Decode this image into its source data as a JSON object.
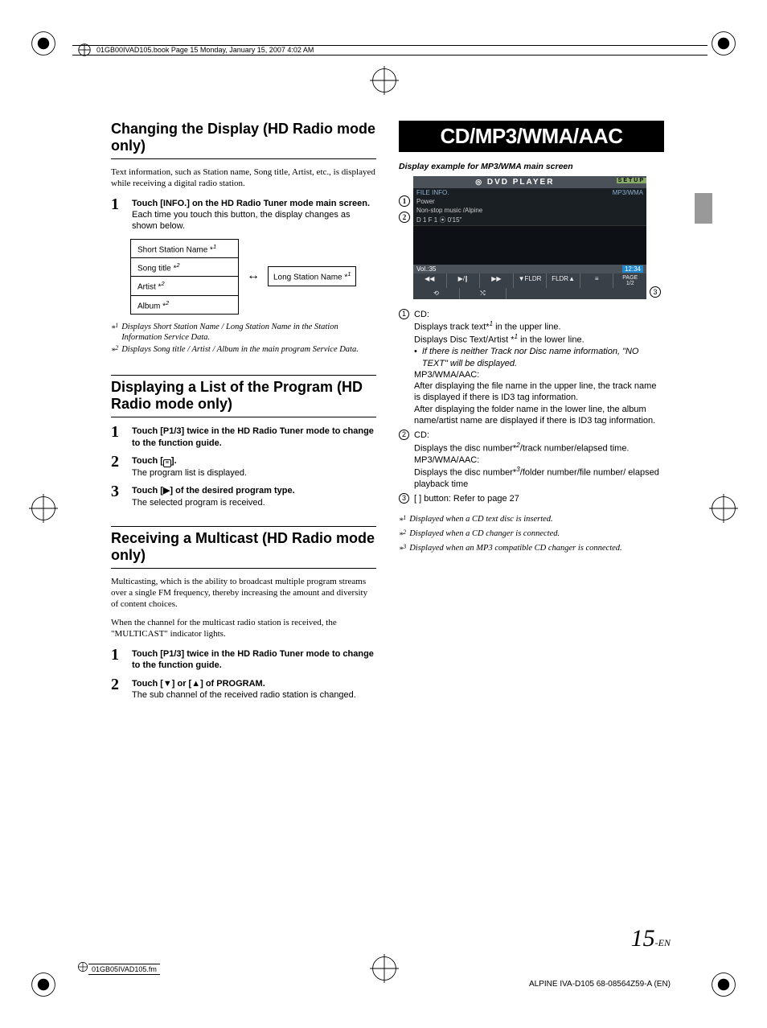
{
  "header_text": "01GB00IVAD105.book  Page 15  Monday, January 15, 2007  4:02 AM",
  "left": {
    "sec1_title": "Changing the Display (HD Radio mode only)",
    "sec1_intro": "Text information, such as Station name, Song title, Artist, etc., is displayed while receiving a digital radio station.",
    "step1_bold_a": "Touch ",
    "step1_key": "[INFO.]",
    "step1_bold_b": " on the HD Radio Tuner mode main screen.",
    "step1_reg": "Each time you touch this button, the display changes as shown below.",
    "seq": {
      "b1": "Short Station Name",
      "b2": "Song title",
      "b3": "Artist",
      "b4": "Album",
      "long": "Long Station Name"
    },
    "fn1": "Displays Short Station Name / Long Station Name in the Station Information Service Data.",
    "fn2": "Displays Song title / Artist / Album in the main program Service Data.",
    "sec2_title": "Displaying a List of the Program (HD Radio mode only)",
    "s2_1_a": "Touch ",
    "s2_1_key": "[P1/3]",
    "s2_1_b": " twice in the HD Radio Tuner mode to change to the function guide.",
    "s2_2_a": "Touch [",
    "s2_2_b": "].",
    "s2_2_reg": "The program list is displayed.",
    "s2_3_a": "Touch [",
    "s2_3_b": "] of the desired program type.",
    "s2_3_reg": "The selected program is received.",
    "sec3_title": "Receiving a Multicast (HD Radio mode only)",
    "sec3_intro1": "Multicasting, which is the ability to broadcast multiple program streams over a single FM frequency, thereby increasing the amount and diversity of content choices.",
    "sec3_intro2": "When the channel for the multicast radio station is received, the \"MULTICAST\" indicator lights.",
    "s3_1_a": "Touch ",
    "s3_1_key": "[P1/3]",
    "s3_1_b": " twice in the HD Radio Tuner mode to change to the function guide.",
    "s3_2": "Touch [▼] or [▲] of PROGRAM.",
    "s3_2_reg": "The sub channel of the received radio station is changed."
  },
  "right": {
    "banner": "CD/MP3/WMA/AAC",
    "caption": "Display example for MP3/WMA main screen",
    "scr": {
      "title": "DVD PLAYER",
      "setup": "SETUP",
      "file_info": "FILE INFO.",
      "fmt": "MP3/WMA",
      "line_power": "Power",
      "line_artist": "Non-stop music /Alpine",
      "disc": "D 1   F 1      ⦿    0'15\"",
      "vol": "Vol.:35",
      "time": "12:34",
      "btns": [
        "◀◀",
        "▶/∥",
        "▶▶",
        "▼FLDR",
        "FLDR▲"
      ],
      "btns2": [
        "⟲",
        "⤭"
      ]
    },
    "d1_label": "CD:",
    "d1_l1a": "Displays track text*",
    "d1_l1b": " in the upper line.",
    "d1_l2a": "Displays Disc Text/Artist *",
    "d1_l2b": " in the lower line.",
    "d1_bullet": "If there is neither Track nor Disc name information, \"NO TEXT\" will be displayed.",
    "d1_mp3": "MP3/WMA/AAC:",
    "d1_mp3_a": "After displaying the file name in the upper line, the track name is displayed if there is ID3 tag information.",
    "d1_mp3_b": "After displaying the folder name in the lower line, the album name/artist name are displayed if there is ID3 tag information.",
    "d2_label": "CD:",
    "d2_l1a": "Displays the disc number*",
    "d2_l1b": "/track number/elapsed time.",
    "d2_mp3": "MP3/WMA/AAC:",
    "d2_l2a": "Displays the disc number*",
    "d2_l2b": "/folder number/file number/ elapsed playback time",
    "d3": "[   ] button: Refer to page 27",
    "rfn1": "Displayed when a CD text disc is inserted.",
    "rfn2": "Displayed when a CD changer is connected.",
    "rfn3": "Displayed when an MP3 compatible CD changer is connected."
  },
  "page_num_big": "15",
  "page_num_sm": "-EN",
  "footer_left": "01GB05IVAD105.fm",
  "footer_right": "ALPINE IVA-D105 68-08564Z59-A (EN)"
}
